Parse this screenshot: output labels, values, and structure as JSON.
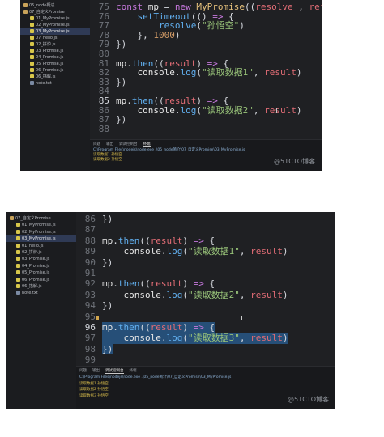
{
  "screenshot1": {
    "tree": [
      {
        "label": "05_node概述",
        "type": "folder"
      },
      {
        "label": "07_自定义Promise",
        "type": "folder"
      },
      {
        "label": "01_MyPromise.js",
        "type": "js"
      },
      {
        "label": "02_MyPromise.js",
        "type": "js"
      },
      {
        "label": "03_MyPromise.js",
        "type": "js",
        "selected": true
      },
      {
        "label": "07_hello.js",
        "type": "js"
      },
      {
        "label": "02_拼炉.js",
        "type": "js"
      },
      {
        "label": "03_Promise.js",
        "type": "js"
      },
      {
        "label": "04_Promise.js",
        "type": "js"
      },
      {
        "label": "05_Promise.js",
        "type": "js"
      },
      {
        "label": "06_Promise.js",
        "type": "js"
      },
      {
        "label": "06_描解.js",
        "type": "js"
      },
      {
        "label": "note.txt",
        "type": "txt"
      }
    ],
    "lines": [
      {
        "n": "75",
        "tokens": [
          [
            "kw",
            "const "
          ],
          [
            "ident",
            "mp "
          ],
          [
            "",
            "= "
          ],
          [
            "kw",
            "new "
          ],
          [
            "cls",
            "MyPromise"
          ],
          [
            "",
            "(("
          ],
          [
            "var",
            "resolve"
          ],
          [
            "",
            " , "
          ],
          [
            "var",
            "reject"
          ],
          [
            "",
            ") "
          ],
          [
            "kw",
            "=>"
          ],
          [
            "",
            " {"
          ]
        ]
      },
      {
        "n": "76",
        "tokens": [
          [
            "",
            "    "
          ],
          [
            "fn",
            "setTimeout"
          ],
          [
            "",
            "(() "
          ],
          [
            "kw",
            "=>"
          ],
          [
            "",
            " {"
          ]
        ]
      },
      {
        "n": "77",
        "tokens": [
          [
            "",
            "        "
          ],
          [
            "fn",
            "resolve"
          ],
          [
            "",
            "("
          ],
          [
            "str",
            "\"孙悟空\""
          ],
          [
            "",
            ")"
          ]
        ]
      },
      {
        "n": "78",
        "tokens": [
          [
            "",
            "    }, "
          ],
          [
            "num",
            "1000"
          ],
          [
            "",
            ")"
          ]
        ]
      },
      {
        "n": "79",
        "tokens": [
          [
            "",
            "})"
          ]
        ]
      },
      {
        "n": "80",
        "tokens": []
      },
      {
        "n": "81",
        "tokens": [
          [
            "ident",
            "mp"
          ],
          [
            "",
            "."
          ],
          [
            "fn",
            "then"
          ],
          [
            "",
            "(("
          ],
          [
            "var",
            "result"
          ],
          [
            "",
            ") "
          ],
          [
            "kw",
            "=>"
          ],
          [
            "",
            " {"
          ]
        ]
      },
      {
        "n": "82",
        "tokens": [
          [
            "",
            "    "
          ],
          [
            "ident",
            "console"
          ],
          [
            "",
            "."
          ],
          [
            "fn",
            "log"
          ],
          [
            "",
            "("
          ],
          [
            "str",
            "\"读取数据1\""
          ],
          [
            "",
            ", "
          ],
          [
            "var",
            "result"
          ],
          [
            "",
            ")"
          ]
        ]
      },
      {
        "n": "83",
        "tokens": [
          [
            "",
            "})"
          ]
        ]
      },
      {
        "n": "84",
        "tokens": []
      },
      {
        "n": "85",
        "tokens": [
          [
            "ident",
            "mp"
          ],
          [
            "",
            "."
          ],
          [
            "fn",
            "then"
          ],
          [
            "",
            "(("
          ],
          [
            "var",
            "result"
          ],
          [
            "",
            ") "
          ],
          [
            "kw",
            "=>"
          ],
          [
            "",
            " {"
          ]
        ],
        "cursor": true
      },
      {
        "n": "86",
        "tokens": [
          [
            "",
            "    "
          ],
          [
            "ident",
            "console"
          ],
          [
            "",
            "."
          ],
          [
            "fn",
            "log"
          ],
          [
            "",
            "("
          ],
          [
            "str",
            "\"读取数据2\""
          ],
          [
            "",
            ", "
          ],
          [
            "var",
            "result"
          ],
          [
            "",
            ")"
          ]
        ]
      },
      {
        "n": "87",
        "tokens": [
          [
            "",
            "})"
          ]
        ]
      },
      {
        "n": "88",
        "tokens": []
      }
    ],
    "panel": {
      "tabs": [
        "问题",
        "输出",
        "调试控制台",
        "终端"
      ],
      "active_tab": 3,
      "output": [
        {
          "kind": "path",
          "text": "C:\\Program Files\\nodejs\\node.exe .\\05_node简介\\07_自定义Promise\\03_MyPromise.js"
        },
        {
          "kind": "res",
          "text": "读取数据1 孙悟空"
        },
        {
          "kind": "res",
          "text": "读取数据2 孙悟空"
        }
      ]
    },
    "watermark": "@51CTO博客"
  },
  "screenshot2": {
    "tree": [
      {
        "label": "07_自定义Promise",
        "type": "folder"
      },
      {
        "label": "01_MyPromise.js",
        "type": "js"
      },
      {
        "label": "02_MyPromise.js",
        "type": "js"
      },
      {
        "label": "03_MyPromise.js",
        "type": "js",
        "selected": true
      },
      {
        "label": "01_hello.js",
        "type": "js"
      },
      {
        "label": "02_拼炉.js",
        "type": "js"
      },
      {
        "label": "03_Promise.js",
        "type": "js"
      },
      {
        "label": "04_Promise.js",
        "type": "js"
      },
      {
        "label": "05_Promise.js",
        "type": "js"
      },
      {
        "label": "06_Promise.js",
        "type": "js"
      },
      {
        "label": "06_描解.js",
        "type": "js"
      },
      {
        "label": "note.txt",
        "type": "txt"
      }
    ],
    "lines": [
      {
        "n": "86",
        "tokens": [
          [
            "",
            "})"
          ]
        ]
      },
      {
        "n": "87",
        "tokens": []
      },
      {
        "n": "88",
        "tokens": [
          [
            "ident",
            "mp"
          ],
          [
            "",
            "."
          ],
          [
            "fn",
            "then"
          ],
          [
            "",
            "(("
          ],
          [
            "var",
            "result"
          ],
          [
            "",
            ") "
          ],
          [
            "kw",
            "=>"
          ],
          [
            "",
            " {"
          ]
        ]
      },
      {
        "n": "89",
        "tokens": [
          [
            "",
            "    "
          ],
          [
            "ident",
            "console"
          ],
          [
            "",
            "."
          ],
          [
            "fn",
            "log"
          ],
          [
            "",
            "("
          ],
          [
            "str",
            "\"读取数据1\""
          ],
          [
            "",
            ", "
          ],
          [
            "var",
            "result"
          ],
          [
            "",
            ")"
          ]
        ]
      },
      {
        "n": "90",
        "tokens": [
          [
            "",
            "})"
          ]
        ]
      },
      {
        "n": "91",
        "tokens": []
      },
      {
        "n": "92",
        "tokens": [
          [
            "ident",
            "mp"
          ],
          [
            "",
            "."
          ],
          [
            "fn",
            "then"
          ],
          [
            "",
            "(("
          ],
          [
            "var",
            "result"
          ],
          [
            "",
            ") "
          ],
          [
            "kw",
            "=>"
          ],
          [
            "",
            " {"
          ]
        ]
      },
      {
        "n": "93",
        "tokens": [
          [
            "",
            "    "
          ],
          [
            "ident",
            "console"
          ],
          [
            "",
            "."
          ],
          [
            "fn",
            "log"
          ],
          [
            "",
            "("
          ],
          [
            "str",
            "\"读取数据2\""
          ],
          [
            "",
            ", "
          ],
          [
            "var",
            "result"
          ],
          [
            "",
            ")"
          ]
        ]
      },
      {
        "n": "94",
        "tokens": [
          [
            "",
            "})"
          ]
        ]
      },
      {
        "n": "95",
        "tokens": []
      },
      {
        "n": "96",
        "tokens": [
          [
            "ident",
            "mp"
          ],
          [
            "",
            "."
          ],
          [
            "fn",
            "then"
          ],
          [
            "",
            "(("
          ],
          [
            "var",
            "result"
          ],
          [
            "",
            ") "
          ],
          [
            "kw",
            "=>"
          ],
          [
            "",
            " {"
          ]
        ],
        "hl": true,
        "cursor": true
      },
      {
        "n": "97",
        "tokens": [
          [
            "",
            "    "
          ],
          [
            "ident",
            "console"
          ],
          [
            "",
            "."
          ],
          [
            "fn",
            "log"
          ],
          [
            "",
            "("
          ],
          [
            "str",
            "\"读取数据3\""
          ],
          [
            "",
            ", "
          ],
          [
            "var",
            "result"
          ],
          [
            "",
            ")"
          ]
        ],
        "hl": true
      },
      {
        "n": "98",
        "tokens": [
          [
            "",
            "})"
          ]
        ],
        "hl": true
      },
      {
        "n": "99",
        "tokens": []
      }
    ],
    "panel": {
      "tabs": [
        "问题",
        "输出",
        "调试控制台",
        "终端"
      ],
      "active_tab": 2,
      "output": [
        {
          "kind": "path",
          "text": "C:\\Program Files\\nodejs\\node.exe .\\05_node简介\\07_自定义Promise\\03_MyPromise.js"
        },
        {
          "kind": "res",
          "text": "读取数据1 孙悟空"
        },
        {
          "kind": "res",
          "text": "读取数据2 孙悟空"
        },
        {
          "kind": "res",
          "text": "读取数据3 孙悟空"
        }
      ]
    },
    "watermark": "@51CTO博客"
  }
}
